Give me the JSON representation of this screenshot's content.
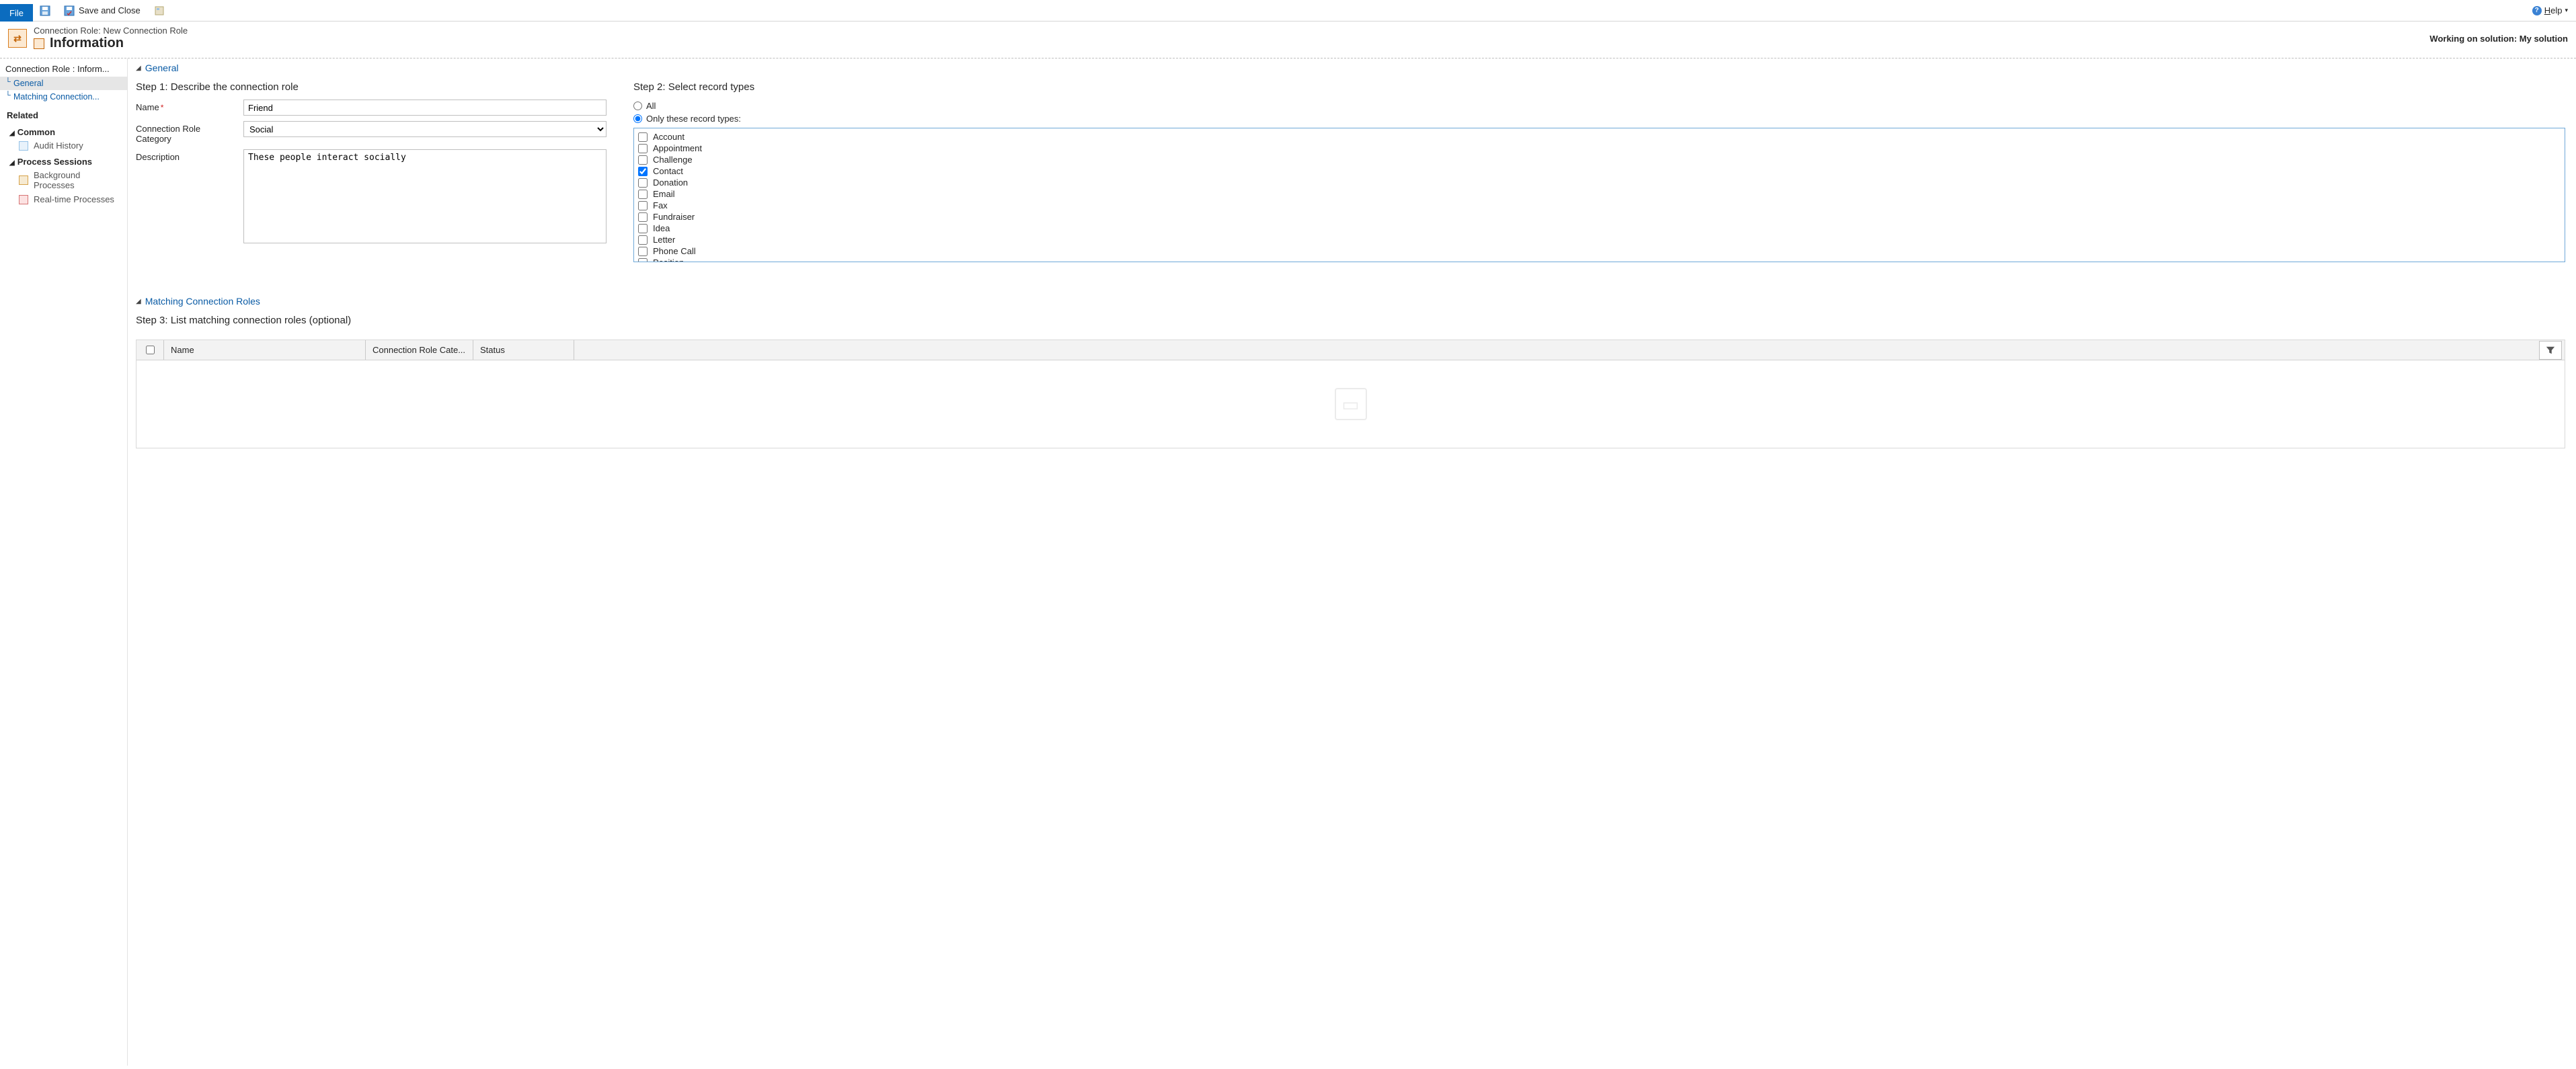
{
  "ribbon": {
    "file_tab": "File",
    "save_and_close": "Save and Close",
    "help_label": "Help"
  },
  "header": {
    "breadcrumb": "Connection Role: New Connection Role",
    "title": "Information",
    "working_on_prefix": "Working on solution: ",
    "working_on_value": "My solution"
  },
  "sidebar": {
    "nav_title": "Connection Role : Inform...",
    "tree_general": "General",
    "tree_matching": "Matching Connection...",
    "related_title": "Related",
    "common_title": "Common",
    "audit_history": "Audit History",
    "process_sessions_title": "Process Sessions",
    "bg_processes": "Background Processes",
    "rt_processes": "Real-time Processes"
  },
  "general": {
    "section_title": "General",
    "step1_title": "Step 1: Describe the connection role",
    "name_label": "Name",
    "name_value": "Friend",
    "category_label": "Connection Role Category",
    "category_value": "Social",
    "description_label": "Description",
    "description_value": "These people interact socially",
    "step2_title": "Step 2: Select record types",
    "radio_all": "All",
    "radio_only": "Only these record types:",
    "record_types": [
      {
        "label": "Account",
        "checked": false
      },
      {
        "label": "Appointment",
        "checked": false
      },
      {
        "label": "Challenge",
        "checked": false
      },
      {
        "label": "Contact",
        "checked": true
      },
      {
        "label": "Donation",
        "checked": false
      },
      {
        "label": "Email",
        "checked": false
      },
      {
        "label": "Fax",
        "checked": false
      },
      {
        "label": "Fundraiser",
        "checked": false
      },
      {
        "label": "Idea",
        "checked": false
      },
      {
        "label": "Letter",
        "checked": false
      },
      {
        "label": "Phone Call",
        "checked": false
      },
      {
        "label": "Position",
        "checked": false
      }
    ]
  },
  "matching": {
    "section_title": "Matching Connection Roles",
    "step3_title": "Step 3: List matching connection roles (optional)",
    "columns": [
      "Name",
      "Connection Role Cate...",
      "Status"
    ]
  }
}
